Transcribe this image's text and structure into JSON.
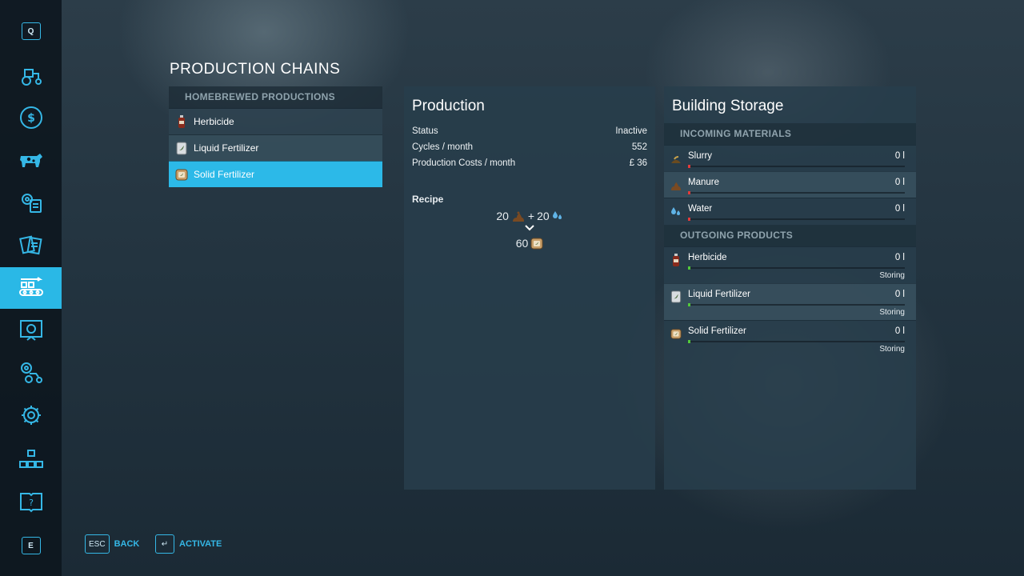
{
  "sidebar": {
    "top_key": "Q",
    "bottom_key": "E",
    "items": [
      {
        "icon": "tractor-icon"
      },
      {
        "icon": "dollar-icon"
      },
      {
        "icon": "cow-icon"
      },
      {
        "icon": "gear-document-icon"
      },
      {
        "icon": "contracts-icon"
      },
      {
        "icon": "production-chain-icon",
        "active": true
      },
      {
        "icon": "statistics-board-icon"
      },
      {
        "icon": "vehicle-gear-icon"
      },
      {
        "icon": "settings-gear-icon"
      },
      {
        "icon": "hierarchy-icon"
      },
      {
        "icon": "help-book-icon"
      }
    ]
  },
  "page_title": "PRODUCTION CHAINS",
  "productions": {
    "header": "HOMEBREWED PRODUCTIONS",
    "items": [
      {
        "label": "Herbicide",
        "icon": "herbicide-bottle-icon"
      },
      {
        "label": "Liquid Fertilizer",
        "icon": "liquid-fertilizer-icon"
      },
      {
        "label": "Solid Fertilizer",
        "icon": "solid-fertilizer-icon",
        "selected": true
      }
    ]
  },
  "production": {
    "title": "Production",
    "stats": [
      {
        "label": "Status",
        "value": "Inactive"
      },
      {
        "label": "Cycles / month",
        "value": "552"
      },
      {
        "label": "Production Costs / month",
        "value": "£ 36"
      }
    ],
    "recipe_label": "Recipe",
    "recipe": {
      "input_a_amount": "20",
      "plus": "+",
      "input_b_amount": "20",
      "output_amount": "60"
    }
  },
  "storage": {
    "title": "Building Storage",
    "incoming_header": "INCOMING MATERIALS",
    "incoming": [
      {
        "name": "Slurry",
        "value": "0 l",
        "icon": "slurry-icon"
      },
      {
        "name": "Manure",
        "value": "0 l",
        "icon": "manure-icon"
      },
      {
        "name": "Water",
        "value": "0 l",
        "icon": "water-drops-icon"
      }
    ],
    "outgoing_header": "OUTGOING PRODUCTS",
    "outgoing": [
      {
        "name": "Herbicide",
        "value": "0 l",
        "mode": "Storing",
        "icon": "herbicide-bottle-icon"
      },
      {
        "name": "Liquid Fertilizer",
        "value": "0 l",
        "mode": "Storing",
        "icon": "liquid-fertilizer-icon"
      },
      {
        "name": "Solid Fertilizer",
        "value": "0 l",
        "mode": "Storing",
        "icon": "solid-fertilizer-icon"
      }
    ]
  },
  "footer": {
    "back_key": "ESC",
    "back_label": "BACK",
    "activate_key": "↵",
    "activate_label": "ACTIVATE"
  },
  "colors": {
    "accent": "#2cb9e8",
    "empty_indicator": "#e23a3a",
    "storing_indicator": "#52c93a"
  }
}
